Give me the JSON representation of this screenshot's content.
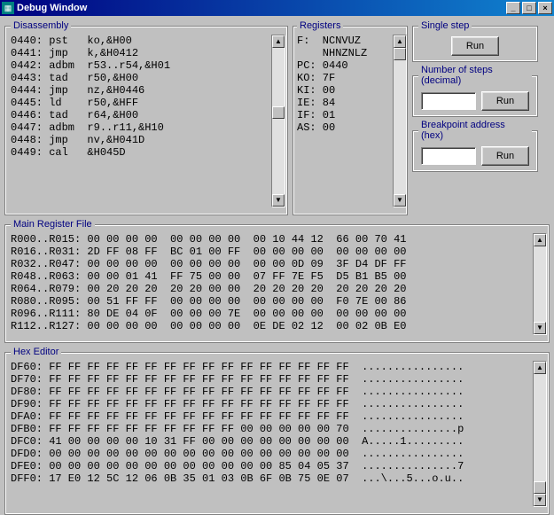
{
  "title": "Debug Window",
  "labels": {
    "disassembly": "Disassembly",
    "registers": "Registers",
    "single_step": "Single step",
    "num_steps": "Number of steps (decimal)",
    "breakpoint": "Breakpoint address (hex)",
    "main_reg": "Main Register File",
    "hex_editor": "Hex Editor",
    "run": "Run"
  },
  "disasm": [
    "0440: pst   ko,&H00",
    "0441: jmp   k,&H0412",
    "0442: adbm  r53..r54,&H01",
    "0443: tad   r50,&H00",
    "0444: jmp   nz,&H0446",
    "0445: ld    r50,&HFF",
    "0446: tad   r64,&H00",
    "0447: adbm  r9..r11,&H10",
    "0448: jmp   nv,&H041D",
    "0449: cal   &H045D"
  ],
  "regs": {
    "flags_row1": "F:  NCNVUZ",
    "flags_row2": "    NHNZNLZ",
    "lines": [
      "PC: 0440",
      "KO: 7F",
      "KI: 00",
      "IE: 84",
      "IF: 01",
      "AS: 00"
    ]
  },
  "inputs": {
    "steps": "",
    "breakpoint": ""
  },
  "main_reg": [
    "R000..R015: 00 00 00 00  00 00 00 00  00 10 44 12  66 00 70 41",
    "R016..R031: 2D FF 08 FF  BC 01 00 FF  00 00 00 00  00 00 00 00",
    "R032..R047: 00 00 00 00  00 00 00 00  00 00 0D 09  3F D4 DF FF",
    "R048..R063: 00 00 01 41  FF 75 00 00  07 FF 7E F5  D5 B1 B5 00",
    "R064..R079: 00 20 20 20  20 20 00 00  20 20 20 20  20 20 20 20",
    "R080..R095: 00 51 FF FF  00 00 00 00  00 00 00 00  F0 7E 00 86",
    "R096..R111: 80 DE 04 0F  00 00 00 7E  00 00 00 00  00 00 00 00",
    "R112..R127: 00 00 00 00  00 00 00 00  0E DE 02 12  00 02 0B E0"
  ],
  "hex": [
    "DF60: FF FF FF FF FF FF FF FF FF FF FF FF FF FF FF FF  ................",
    "DF70: FF FF FF FF FF FF FF FF FF FF FF FF FF FF FF FF  ................",
    "DF80: FF FF FF FF FF FF FF FF FF FF FF FF FF FF FF FF  ................",
    "DF90: FF FF FF FF FF FF FF FF FF FF FF FF FF FF FF FF  ................",
    "DFA0: FF FF FF FF FF FF FF FF FF FF FF FF FF FF FF FF  ................",
    "DFB0: FF FF FF FF FF FF FF FF FF FF 00 00 00 00 00 70  ...............p",
    "DFC0: 41 00 00 00 00 10 31 FF 00 00 00 00 00 00 00 00  A.....1.........",
    "DFD0: 00 00 00 00 00 00 00 00 00 00 00 00 00 00 00 00  ................",
    "DFE0: 00 00 00 00 00 00 00 00 00 00 00 00 85 04 05 37  ...............7",
    "DFF0: 17 E0 12 5C 12 06 0B 35 01 03 0B 6F 0B 75 0E 07  ...\\...5...o.u.."
  ]
}
